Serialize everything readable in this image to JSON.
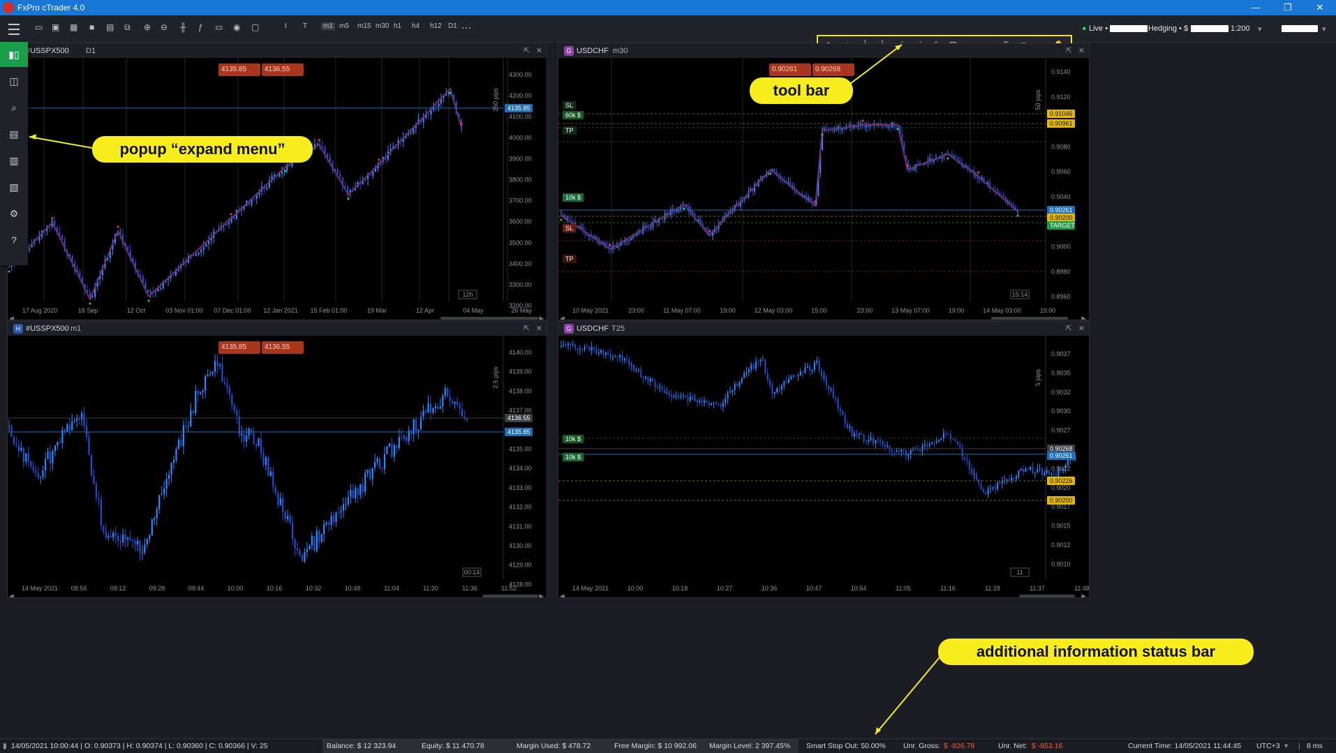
{
  "app": {
    "title": "FxPro cTrader 4.0"
  },
  "topbar": {
    "timeframes": [
      "t",
      "T",
      "m1",
      "m5",
      "m15",
      "m30",
      "h1",
      "h4",
      "h12",
      "D1"
    ],
    "more": "…",
    "account_mode": "Live •",
    "hedging": "Hedging • $",
    "leverage": "1:200"
  },
  "toolbar_tools": [
    "pointer",
    "crosshair",
    "measure",
    "vertical-line",
    "trend-line",
    "fibonacci",
    "pitchfork",
    "grid",
    "rectangle",
    "ellipse",
    "text",
    "note",
    "eye",
    "alert"
  ],
  "sidebar": {
    "items": [
      "trade",
      "copy",
      "analyze",
      "expand-menu",
      "store",
      "portfolio",
      "settings",
      "help"
    ]
  },
  "panels": {
    "tl": {
      "symbol": "#USSPX500",
      "timeframe": "D1",
      "sell": "4135.85",
      "buy": "4136.55",
      "range": "250 pips",
      "price": "4135.85",
      "timer": "12h",
      "y_ticks": [
        "4300.00",
        "4200.00",
        "4100.00",
        "4000.00",
        "3900.00",
        "3800.00",
        "3700.00",
        "3600.00",
        "3500.00",
        "3400.00",
        "3300.00",
        "3200.00"
      ],
      "x_ticks": [
        "17 Aug 2020",
        "18 Sep",
        "12 Oct",
        "03 Nov 01:00",
        "07 Dec 01:00",
        "12 Jan 2021",
        "15 Feb 01:00",
        "19 Mar",
        "12 Apr",
        "04 May",
        "26 May"
      ]
    },
    "tr": {
      "symbol": "USDCHF",
      "timeframe": "m30",
      "sell": "0.90261",
      "buy": "0.90268",
      "range": "50 pips",
      "price_a": "0.91046",
      "price_b": "0.90961",
      "price_c": "0.90261",
      "price_d": "0.90200",
      "target": "TARGET",
      "timer": "15:14",
      "y_ticks": [
        "0.9140",
        "0.9120",
        "0.9100",
        "0.9080",
        "0.9060",
        "0.9040",
        "0.9020",
        "0.9000",
        "0.8980",
        "0.8960"
      ],
      "x_ticks": [
        "10 May 2021",
        "23:00",
        "11 May 07:00",
        "19:00",
        "12 May 03:00",
        "15:00",
        "23:00",
        "13 May 07:00",
        "19:00",
        "14 May 03:00",
        "15:00"
      ],
      "positions": [
        "60k $",
        "10k $",
        "SL",
        "TP",
        "SL",
        "TP"
      ]
    },
    "bl": {
      "symbol": "#USSPX500",
      "timeframe": "m1",
      "sell": "4135.85",
      "buy": "4136.55",
      "range": "2.5 pips",
      "price_a": "4136.55",
      "price_b": "4135.85",
      "timer": "00:14",
      "y_ticks": [
        "4140.00",
        "4139.00",
        "4138.00",
        "4137.00",
        "4136.00",
        "4135.00",
        "4134.00",
        "4133.00",
        "4132.00",
        "4131.00",
        "4130.00",
        "4129.00",
        "4128.00"
      ],
      "x_ticks": [
        "14 May 2021",
        "08:56",
        "09:12",
        "09:28",
        "09:44",
        "10:00",
        "10:16",
        "10:32",
        "10:48",
        "11:04",
        "11:20",
        "11:36",
        "11:52"
      ]
    },
    "br": {
      "symbol": "USDCHF",
      "timeframe": "T25",
      "range": "5 pips",
      "price_a": "0.90268",
      "price_b": "0.90261",
      "price_c": "0.90226",
      "price_d": "0.90200",
      "timer": "11",
      "y_ticks": [
        "0.9037",
        "0.9035",
        "0.9032",
        "0.9030",
        "0.9027",
        "0.9025",
        "0.9022",
        "0.9020",
        "0.9017",
        "0.9015",
        "0.9012",
        "0.9010"
      ],
      "x_ticks": [
        "14 May 2021",
        "10:00",
        "10:18",
        "10:27",
        "10:36",
        "10:47",
        "10:54",
        "11:05",
        "11:16",
        "11:28",
        "11:37",
        "11:48"
      ],
      "positions": [
        "10k $",
        "10k $"
      ]
    }
  },
  "callouts": {
    "toolbar": "tool bar",
    "expand": "popup “expand menu”",
    "status": "additional information status bar"
  },
  "status": {
    "ohlc": "14/05/2021 10:00:44 | O: 0.90373 | H: 0.90374 | L: 0.90360 | C: 0.90366 | V: 25",
    "balance": "Balance: $ 12 323.94",
    "equity": "Equity: $ 11 470.78",
    "margin_used": "Margin Used: $ 478.72",
    "free_margin": "Free Margin: $ 10 992.06",
    "margin_level": "Margin Level: 2 397.45%",
    "smart_stop": "Smart Stop Out: 50.00%",
    "unr_gross_label": "Unr. Gross:",
    "unr_gross": "$ -826.78",
    "unr_net_label": "Unr. Net:",
    "unr_net": "$ -853.16",
    "current_time": "Current Time:  14/05/2021 11:44:45",
    "tz": "UTC+3",
    "ping": "8 ms"
  },
  "colors": {
    "accent": "#1877d4",
    "candle_up": "#2f8cff",
    "candle_down": "#1e4fd0",
    "zigzag": "#7a2a6e",
    "sell": "#a8351c",
    "callout": "#f8ee1e"
  }
}
